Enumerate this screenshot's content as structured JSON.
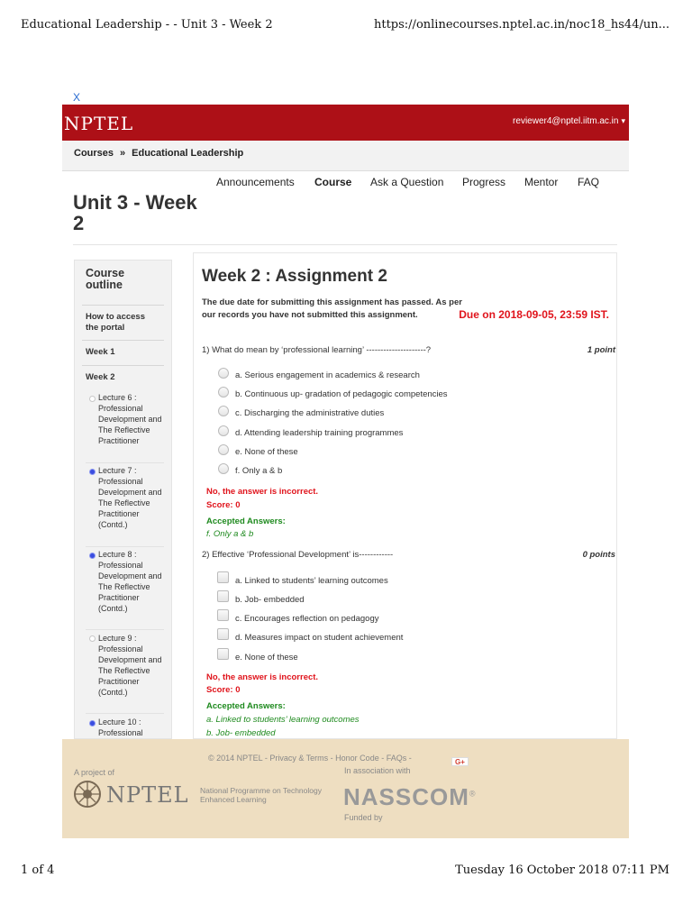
{
  "print": {
    "header_left": "Educational Leadership - - Unit 3 - Week 2",
    "header_right": "https://onlinecourses.nptel.ac.in/noc18_hs44/un...",
    "footer_left": "1 of 4",
    "footer_right": "Tuesday 16 October 2018 07:11 PM"
  },
  "close_label": "X",
  "topbar": {
    "logo": "NPTEL",
    "user": "reviewer4@nptel.iitm.ac.in",
    "caret": "▾"
  },
  "breadcrumb": {
    "courses": "Courses",
    "separator": "»",
    "course": "Educational Leadership"
  },
  "page_title": "Unit 3 - Week 2",
  "nav": [
    "Announcements",
    "Course",
    "Ask a Question",
    "Progress",
    "Mentor",
    "FAQ"
  ],
  "nav_active": "Course",
  "sidebar": {
    "title": "Course outline",
    "items": [
      "How to access the portal",
      "Week 1",
      "Week 2"
    ],
    "lectures": [
      {
        "label": "Lecture 6 : Professional Development and The Reflective Practitioner",
        "status": "todo"
      },
      {
        "label": "Lecture 7 : Professional Development and The Reflective Practitioner (Contd.)",
        "status": "done"
      },
      {
        "label": "Lecture 8 : Professional Development and The Reflective Practitioner (Contd.)",
        "status": "done"
      },
      {
        "label": "Lecture 9 : Professional Development and The Reflective Practitioner (Contd.)",
        "status": "todo"
      },
      {
        "label": "Lecture 10 : Professional",
        "status": "done"
      }
    ]
  },
  "assignment": {
    "title": "Week 2 : Assignment 2",
    "due_note": "The due date for submitting this assignment has passed. As per our records you have not submitted this assignment.",
    "due_date": "Due on 2018-09-05, 23:59 IST.",
    "questions": [
      {
        "text": "1) What do mean by ‘professional learning’ ---------------------?",
        "points": "1 point",
        "type": "radio",
        "options": [
          "a. Serious engagement in academics & research",
          "b. Continuous up- gradation of pedagogic competencies",
          "c. Discharging the administrative duties",
          "d. Attending leadership training programmes",
          "e. None of these",
          "f. Only a & b"
        ],
        "result": "No, the answer is incorrect.",
        "score": "Score: 0",
        "accepted_label": "Accepted Answers:",
        "accepted": [
          "f. Only a & b"
        ]
      },
      {
        "text": "2) Effective ‘Professional Development’ is------------",
        "points": "0 points",
        "type": "checkbox",
        "options": [
          "a. Linked to students’ learning outcomes",
          "b. Job- embedded",
          "c. Encourages reflection on pedagogy",
          "d. Measures impact on student achievement",
          "e. None of these"
        ],
        "result": "No, the answer is incorrect.",
        "score": "Score: 0",
        "accepted_label": "Accepted Answers:",
        "accepted": [
          "a. Linked to students’ learning outcomes",
          "b. Job- embedded"
        ]
      }
    ]
  },
  "footer": {
    "copyright": "© 2014 NPTEL - Privacy & Terms - Honor Code - FAQs -",
    "gplus": "G+",
    "project_of": "A project of",
    "nptel_word": "NPTEL",
    "nptel_tagline": "National Programme on Technology Enhanced Learning",
    "association": "In association with",
    "nasscom": "NASSCOM",
    "nasscom_mark": "®",
    "funded_by": "Funded by"
  }
}
